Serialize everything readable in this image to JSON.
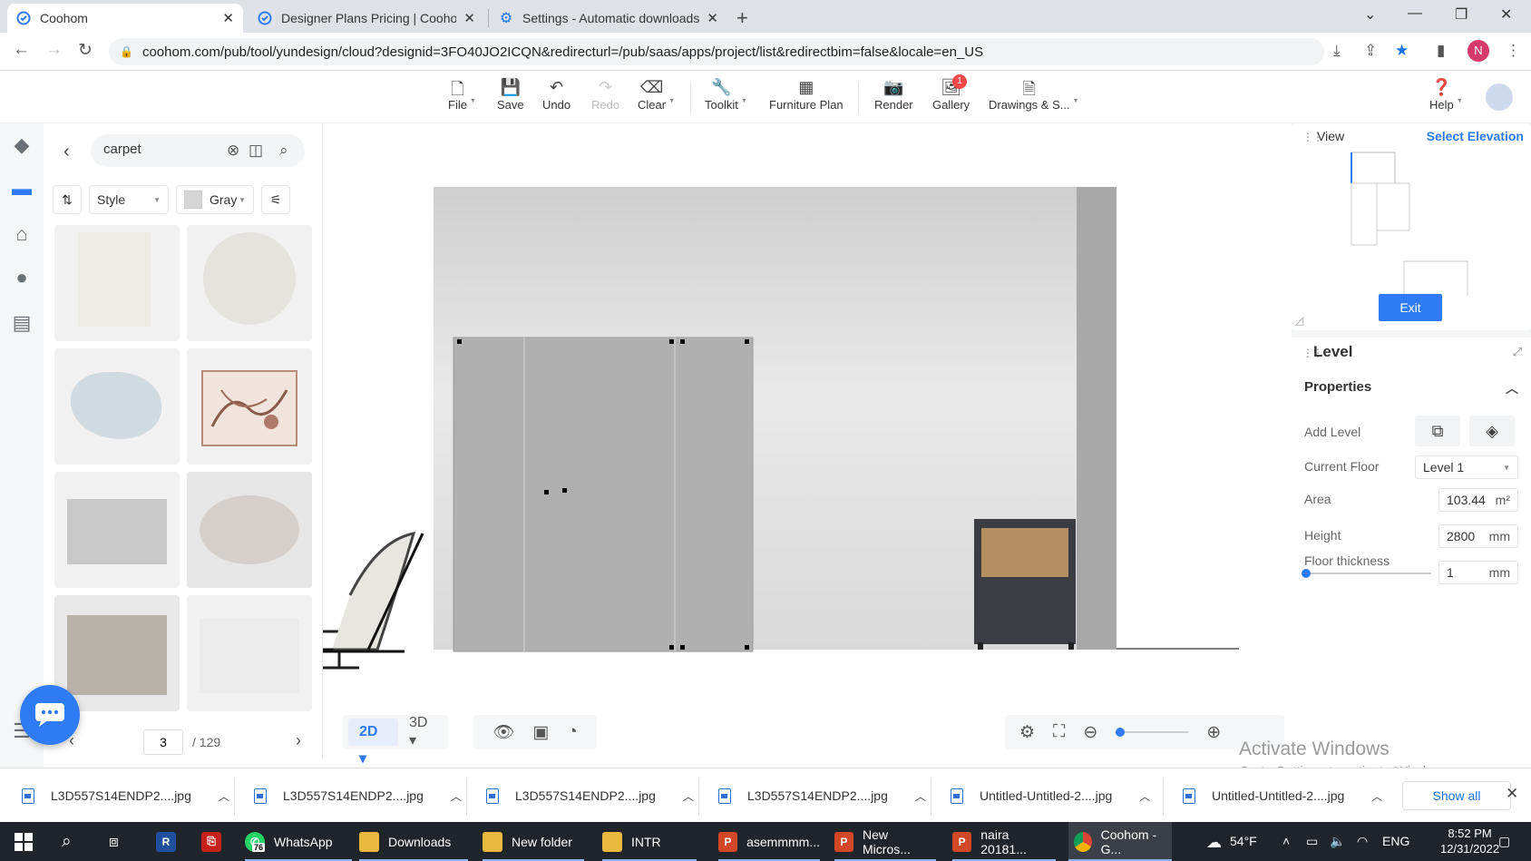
{
  "browser": {
    "tabs": [
      {
        "title": "Coohom",
        "active": true
      },
      {
        "title": "Designer Plans Pricing | Coohom",
        "active": false
      },
      {
        "title": "Settings - Automatic downloads",
        "active": false
      }
    ],
    "url": "coohom.com/pub/tool/yundesign/cloud?designid=3FO40JO2ICQN&redirecturl=/pub/saas/apps/project/list&redirectbim=false&locale=en_US",
    "profile_initial": "N"
  },
  "toolbar": {
    "items": [
      {
        "label": "File",
        "icon": "file-icon"
      },
      {
        "label": "Save",
        "icon": "save-icon"
      },
      {
        "label": "Undo",
        "icon": "undo-icon"
      },
      {
        "label": "Redo",
        "icon": "redo-icon",
        "disabled": true
      },
      {
        "label": "Clear",
        "icon": "eraser-icon"
      },
      {
        "label": "Toolkit",
        "icon": "wrench-icon"
      },
      {
        "label": "Furniture Plan",
        "icon": "furniture-plan-icon"
      },
      {
        "label": "Render",
        "icon": "camera-icon"
      },
      {
        "label": "Gallery",
        "icon": "gallery-icon",
        "badge": "1"
      },
      {
        "label": "Drawings & S...",
        "icon": "drawings-icon"
      }
    ],
    "help_label": "Help"
  },
  "left_panel": {
    "search_value": "carpet",
    "filters": {
      "style_label": "Style",
      "color_label": "Gray"
    },
    "pager": {
      "current": "3",
      "total": "/ 129"
    }
  },
  "canvas": {
    "view_modes": [
      "2D",
      "3D"
    ],
    "active_view": "2D"
  },
  "right_panel": {
    "view": {
      "title": "View",
      "select_label": "Select Elevation",
      "exit_label": "Exit"
    },
    "level": {
      "title": "Level",
      "properties_label": "Properties",
      "add_level_label": "Add Level",
      "current_floor_label": "Current Floor",
      "current_floor_value": "Level 1",
      "area_label": "Area",
      "area_value": "103.44",
      "area_unit": "m²",
      "height_label": "Height",
      "height_value": "2800",
      "height_unit": "mm",
      "floor_thickness_label": "Floor thickness",
      "floor_thickness_value": "1",
      "floor_thickness_unit": "mm"
    }
  },
  "watermark": {
    "line1": "Activate Windows",
    "line2": "Go to Settings to activate Windows."
  },
  "downloads": {
    "items": [
      "L3D557S14ENDP2....jpg",
      "L3D557S14ENDP2....jpg",
      "L3D557S14ENDP2....jpg",
      "L3D557S14ENDP2....jpg",
      "Untitled-Untitled-2....jpg",
      "Untitled-Untitled-2....jpg"
    ],
    "show_all": "Show all"
  },
  "taskbar": {
    "apps": [
      {
        "label": "",
        "icon": "R"
      },
      {
        "label": "",
        "icon": "pdf"
      },
      {
        "label": "WhatsApp",
        "icon": "whatsapp",
        "badge": "76"
      },
      {
        "label": "Downloads",
        "icon": "folder"
      },
      {
        "label": "New folder",
        "icon": "folder"
      },
      {
        "label": "INTR",
        "icon": "folder"
      },
      {
        "label": "asemmmm...",
        "icon": "P"
      },
      {
        "label": "New Micros...",
        "icon": "P"
      },
      {
        "label": "naira 20181...",
        "icon": "P"
      },
      {
        "label": "Coohom - G...",
        "icon": "chrome"
      }
    ],
    "weather": "54°F",
    "language": "ENG",
    "time": "8:52 PM",
    "date": "12/31/2022"
  }
}
